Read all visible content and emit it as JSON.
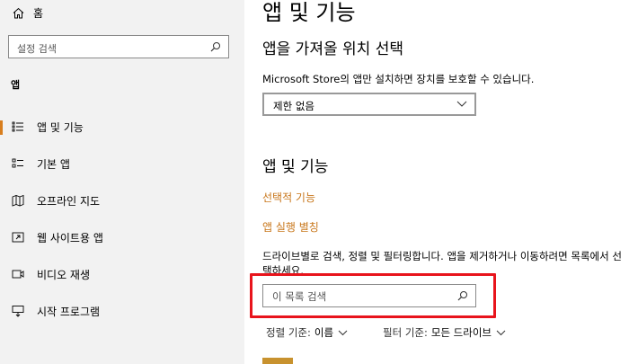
{
  "sidebar": {
    "home_label": "홈",
    "search_placeholder": "설정 검색",
    "section_label": "앱",
    "items": [
      {
        "label": "앱 및 기능"
      },
      {
        "label": "기본 앱"
      },
      {
        "label": "오프라인 지도"
      },
      {
        "label": "웹 사이트용 앱"
      },
      {
        "label": "비디오 재생"
      },
      {
        "label": "시작 프로그램"
      }
    ]
  },
  "main": {
    "page_title": "앱 및 기능",
    "install_section": {
      "title": "앱을 가져올 위치 선택",
      "description": "Microsoft Store의 앱만 설치하면 장치를 보호할 수 있습니다.",
      "dropdown_value": "제한 없음"
    },
    "apps_section": {
      "title": "앱 및 기능",
      "link_optional": "선택적 기능",
      "link_aliases": "앱 실행 별칭",
      "description": "드라이브별로 검색, 정렬 및 필터링합니다. 앱을 제거하거나 이동하려면 목록에서 선택하세요.",
      "search_placeholder": "이 목록 검색",
      "sort_label": "정렬 기준:",
      "sort_value": "이름",
      "filter_label": "필터 기준:",
      "filter_value": "모든 드라이브"
    }
  },
  "colors": {
    "accent": "#c8771c",
    "highlight_box": "#e8141c",
    "sidebar_bg": "#f2f2f2"
  }
}
